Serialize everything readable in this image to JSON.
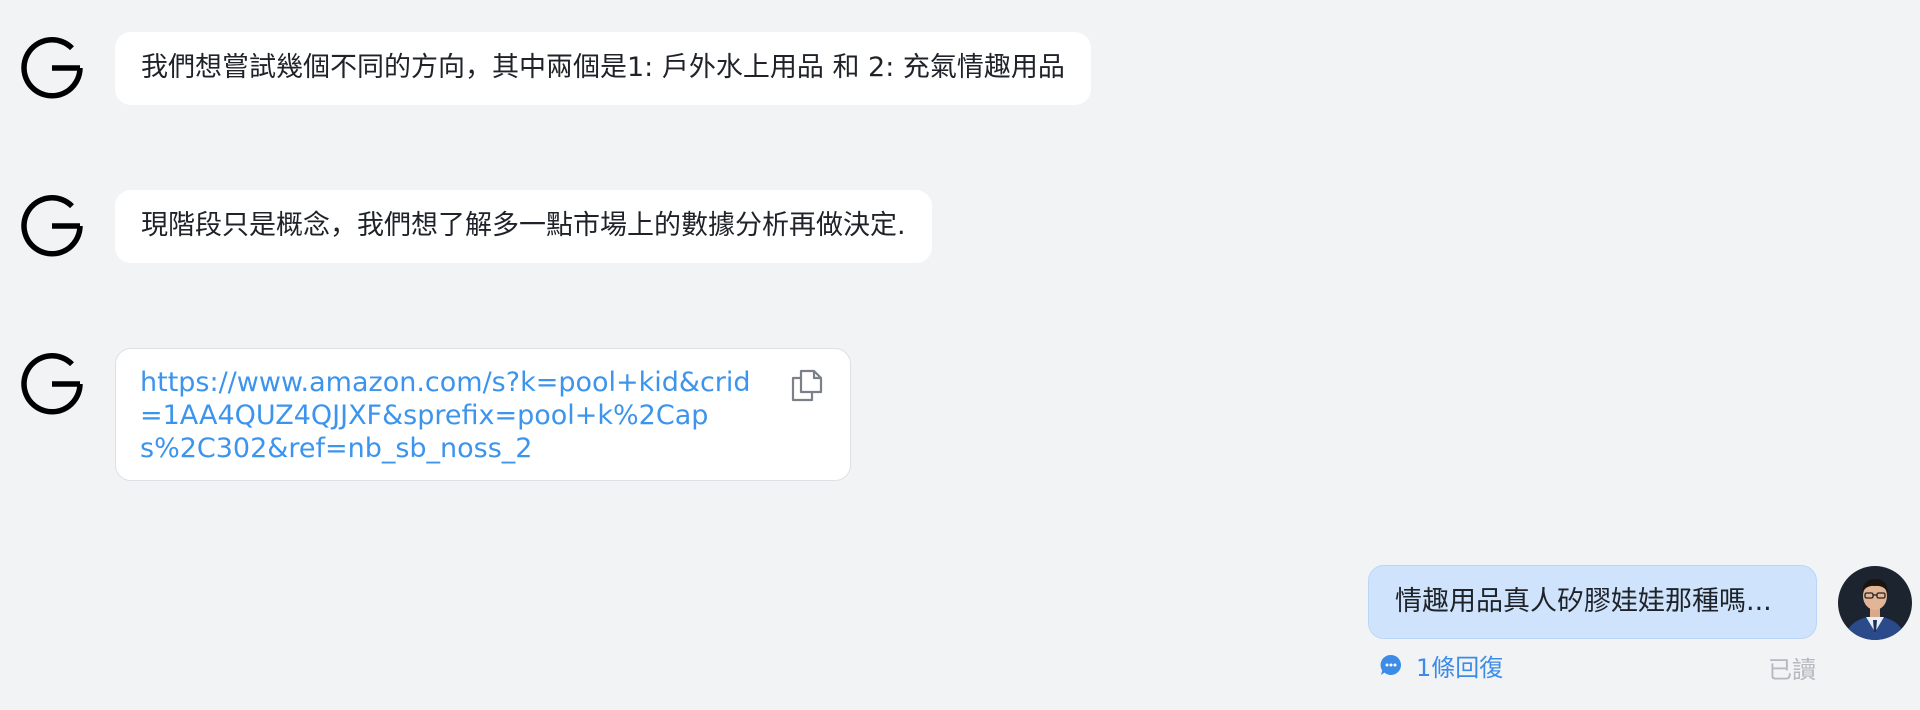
{
  "messages": [
    {
      "sender": "G",
      "text": "我們想嘗試幾個不同的方向，其中兩個是1: 戶外水上用品 和 2: 充氣情趣用品"
    },
    {
      "sender": "G",
      "text": "現階段只是概念，我們想了解多一點市場上的數據分析再做決定."
    },
    {
      "sender": "G",
      "link_lines": [
        "https://www.amazon.com/s?k=pool+kid&crid",
        "=1AA4QUZ4QJJXF&sprefix=pool+k%2Cap",
        "s%2C302&ref=nb_sb_noss_2"
      ]
    },
    {
      "sender": "self",
      "text": "情趣用品真人矽膠娃娃那種嗎..."
    }
  ],
  "thread": {
    "reply_label": "1條回復",
    "read_status": "已讀"
  },
  "icons": {
    "sender_avatar": "letter-g-avatar-icon",
    "copy": "copy-icon",
    "reply": "chat-bubble-icon"
  },
  "colors": {
    "background": "#f2f3f5",
    "link": "#3c94ec",
    "self_bubble": "#cfe4fc",
    "reply": "#3c8ce7",
    "read": "#b4b8bf"
  }
}
